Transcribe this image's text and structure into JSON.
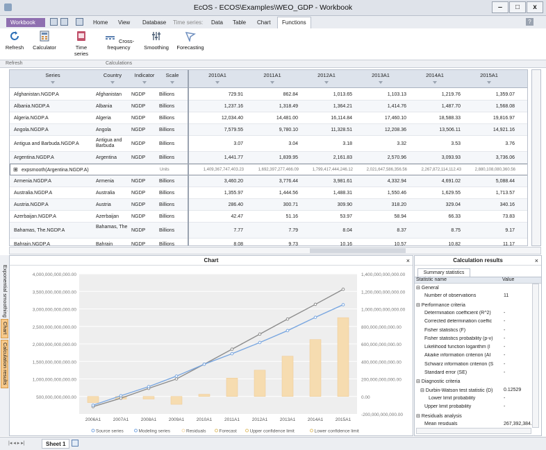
{
  "window": {
    "title": "EcOS - ECOS\\Examples\\WEO_GDP - Workbook",
    "minimize": "‒",
    "maximize": "□",
    "close": "x"
  },
  "menubar": {
    "workbook": "Workbook",
    "tabs": [
      "Home",
      "View",
      "Database"
    ],
    "ts_group": "Time series:",
    "ts_tabs": [
      "Data",
      "Table",
      "Chart",
      "Functions"
    ],
    "help": "?"
  },
  "ribbon": {
    "buttons": [
      "Refresh",
      "Calculator",
      "Time series",
      "Cross-frequency",
      "Smoothing",
      "Forecasting"
    ],
    "groups": [
      "Refresh",
      "Calculations"
    ]
  },
  "grid": {
    "headers": [
      "Series",
      "Country",
      "Indicator",
      "Scale",
      "2010A1",
      "2011A1",
      "2012A1",
      "2013A1",
      "2014A1",
      "2015A1"
    ],
    "rows": [
      [
        "Afghanistan.NGDP.A",
        "Afghanistan",
        "NGDP",
        "Billions",
        "729.91",
        "862.84",
        "1,013.65",
        "1,103.13",
        "1,219.76",
        "1,359.07"
      ],
      [
        "Albania.NGDP.A",
        "Albania",
        "NGDP",
        "Billions",
        "1,237.16",
        "1,318.49",
        "1,364.21",
        "1,414.76",
        "1,487.70",
        "1,568.08"
      ],
      [
        "Algeria.NGDP.A",
        "Algeria",
        "NGDP",
        "Billions",
        "12,034.40",
        "14,481.00",
        "16,114.84",
        "17,460.10",
        "18,588.33",
        "19,816.97"
      ],
      [
        "Angola.NGDP.A",
        "Angola",
        "NGDP",
        "Billions",
        "7,579.55",
        "9,780.10",
        "11,328.51",
        "12,208.36",
        "13,506.11",
        "14,921.16"
      ],
      [
        "Antigua and Barbuda.NGDP.A",
        "Antigua and Barbuda",
        "NGDP",
        "Billions",
        "3.07",
        "3.04",
        "3.18",
        "3.32",
        "3.53",
        "3.76"
      ],
      [
        "Argentina.NGDP.A",
        "Argentina",
        "NGDP",
        "Billions",
        "1,441.77",
        "1,839.95",
        "2,161.83",
        "2,570.96",
        "3,093.93",
        "3,736.06"
      ],
      [
        "expsmooth(Argentina.NGDP.A)",
        "",
        "",
        "Units",
        "1,409,367,747,403.23",
        "1,692,397,277,466.09",
        "1,799,417,444,246.12",
        "2,021,647,586,356.56",
        "2,267,872,114,112.43",
        "2,880,108,080,360.56"
      ],
      [
        "Armenia.NGDP.A",
        "Armenia",
        "NGDP",
        "Billions",
        "3,460.20",
        "3,776.44",
        "3,981.61",
        "4,332.94",
        "4,691.02",
        "5,088.44"
      ],
      [
        "Australia.NGDP.A",
        "Australia",
        "NGDP",
        "Billions",
        "1,355.97",
        "1,444.56",
        "1,488.31",
        "1,550.46",
        "1,629.55",
        "1,713.57"
      ],
      [
        "Austria.NGDP.A",
        "Austria",
        "NGDP",
        "Billions",
        "286.40",
        "300.71",
        "309.90",
        "318.20",
        "329.04",
        "340.16"
      ],
      [
        "Azerbaijan.NGDP.A",
        "Azerbaijan",
        "NGDP",
        "Billions",
        "42.47",
        "51.16",
        "53.97",
        "58.94",
        "66.33",
        "73.83"
      ],
      [
        "Bahamas, The.NGDP.A",
        "Bahamas, The",
        "NGDP",
        "Billions",
        "7.77",
        "7.79",
        "8.04",
        "8.37",
        "8.75",
        "9.17"
      ],
      [
        "Bahrain.NGDP.A",
        "Bahrain",
        "NGDP",
        "Billions",
        "8.08",
        "9.73",
        "10.16",
        "10.57",
        "10.82",
        "11.17"
      ],
      [
        "Bangladesh.NGDP.A",
        "Bangladesh",
        "NGDP",
        "Billions",
        "7,455.14",
        "8,557.44",
        "9,783.03",
        "11,044.78",
        "12,476.87",
        "14,096.50"
      ]
    ]
  },
  "chart": {
    "title": "Chart",
    "close": "×"
  },
  "chart_data": {
    "type": "line",
    "title": "Chart",
    "x": [
      "2006A1",
      "2007A1",
      "2008A1",
      "2009A1",
      "2010A1",
      "2011A1",
      "2012A1",
      "2013A1",
      "2014A1",
      "2015A1"
    ],
    "ylim": [
      0,
      4000000000000
    ],
    "ylim_right": [
      -200000000000,
      1400000000000
    ],
    "yticks": [
      "4,000,000,000,000.00",
      "3,500,000,000,000.00",
      "3,000,000,000,000.00",
      "2,500,000,000,000.00",
      "2,000,000,000,000.00",
      "1,500,000,000,000.00",
      "1,000,000,000,000.00",
      "500,000,000,000.00"
    ],
    "yticks_right": [
      "1,400,000,000,000.00",
      "1,200,000,000,000.00",
      "1,000,000,000,000.00",
      "800,000,000,000.00",
      "600,000,000,000.00",
      "400,000,000,000.00",
      "200,000,000,000.00",
      "0.00",
      "-200,000,000,000.00"
    ],
    "series": [
      {
        "name": "Forecast",
        "values": [
          210000000000,
          450000000000,
          730000000000,
          1000000000000,
          1420000000000,
          1850000000000,
          2280000000000,
          2710000000000,
          3130000000000,
          3560000000000
        ],
        "color": "#8c8c8c"
      },
      {
        "name": "Modeling series",
        "values": [
          250000000000,
          520000000000,
          780000000000,
          1080000000000,
          1420000000000,
          1720000000000,
          2040000000000,
          2380000000000,
          2760000000000,
          3120000000000
        ],
        "color": "#7aa7e0"
      },
      {
        "name": "Residuals",
        "values": [
          -70000000000,
          -30000000000,
          -30000000000,
          -90000000000,
          25000000000,
          210000000000,
          300000000000,
          460000000000,
          650000000000,
          900000000000
        ],
        "color": "#f6dcb0",
        "axis": "right"
      }
    ],
    "legend": [
      "Source series",
      "Modeling series",
      "Residuals",
      "Forecast",
      "Upper confidence limit",
      "Lower confidence limit"
    ],
    "legend_colors": [
      "#7aa7e0",
      "#7aa7e0",
      "#f6dcb0",
      "#e0c070",
      "#e0c070",
      "#e0c070"
    ]
  },
  "calc": {
    "title": "Calculation results",
    "tab": "Summary statistics",
    "cols": [
      "Statistic name",
      "Value"
    ],
    "rows": [
      {
        "t": "⊟ General",
        "v": "",
        "i": 0
      },
      {
        "t": "Number of observations",
        "v": "11",
        "i": 2
      },
      {
        "t": "⊟ Performance criteria",
        "v": "",
        "i": 0
      },
      {
        "t": "Determination coefficient (R^2)",
        "v": "-",
        "i": 2
      },
      {
        "t": "Corrected determination coeffic",
        "v": "-",
        "i": 2
      },
      {
        "t": "Fisher statistics (F)",
        "v": "-",
        "i": 2
      },
      {
        "t": "Fisher statistics probability (p-v)",
        "v": "-",
        "i": 2
      },
      {
        "t": "Likelihood function logarithm (l",
        "v": "-",
        "i": 2
      },
      {
        "t": "Akaike information criterion (AI",
        "v": "-",
        "i": 2
      },
      {
        "t": "Schwarz information criterion (S",
        "v": "-",
        "i": 2
      },
      {
        "t": "Standard error (SE)",
        "v": "-",
        "i": 2
      },
      {
        "t": "⊟ Diagnostic criteria",
        "v": "",
        "i": 0
      },
      {
        "t": "⊟ Durbin-Watson test statistic (D)",
        "v": "0.12529",
        "i": 1
      },
      {
        "t": "Lower limit probability",
        "v": "-",
        "i": 3
      },
      {
        "t": "Upper limit probability",
        "v": "-",
        "i": 2
      },
      {
        "t": "⊟ Residuals analysis",
        "v": "",
        "i": 0
      },
      {
        "t": "Mean residuals",
        "v": "267,392,384.62",
        "i": 2
      }
    ]
  },
  "sidebar": {
    "tabs": [
      "Exponential smoothing",
      "Chart",
      "Calculation results"
    ]
  },
  "sheetbar": {
    "sheet": "Sheet 1"
  }
}
